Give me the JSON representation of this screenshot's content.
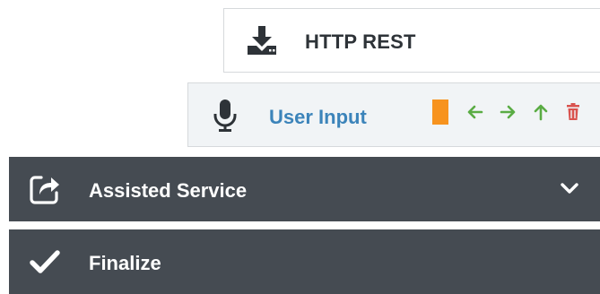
{
  "blocks": {
    "http_rest": {
      "label": "HTTP REST",
      "icon": "download-icon"
    },
    "user_input": {
      "label": "User Input",
      "icon": "microphone-icon",
      "marker_color": "#f7931e",
      "toolbar": {
        "move_left": "arrow-left-icon",
        "move_right": "arrow-right-icon",
        "move_up": "arrow-up-icon",
        "delete": "trash-icon"
      }
    }
  },
  "sections": {
    "assisted_service": {
      "label": "Assisted Service",
      "icon": "share-icon",
      "expand": "chevron-down-icon"
    },
    "finalize": {
      "label": "Finalize",
      "icon": "check-icon"
    }
  },
  "colors": {
    "section_bg": "#454b52",
    "link_blue": "#3c84ba",
    "arrow_green": "#5aac44",
    "delete_red": "#d9534f"
  }
}
